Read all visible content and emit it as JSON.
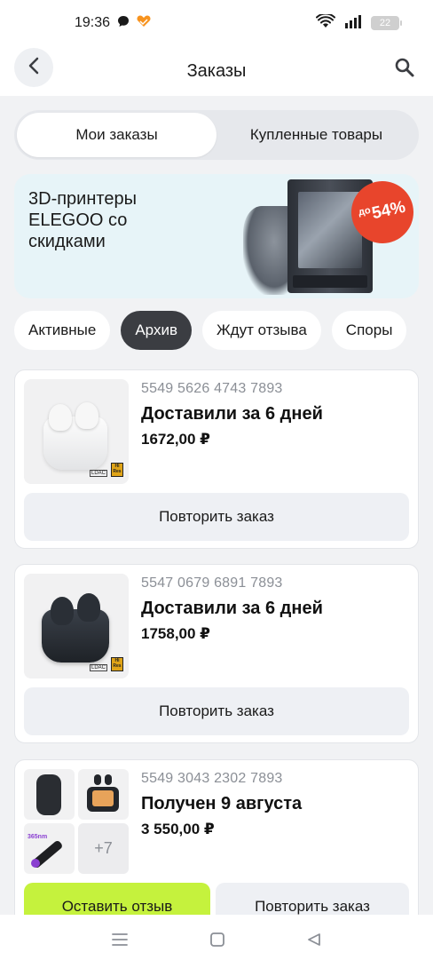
{
  "status_bar": {
    "time": "19:36",
    "battery": "22",
    "icons": [
      "chat-bubble-icon",
      "heart-app-icon",
      "wifi-icon",
      "signal-icon",
      "battery-icon"
    ]
  },
  "header": {
    "title": "Заказы",
    "back_icon": "chevron-left-icon",
    "search_icon": "search-icon"
  },
  "tabs": [
    {
      "label": "Мои заказы",
      "active": true
    },
    {
      "label": "Купленные товары",
      "active": false
    }
  ],
  "banner": {
    "text": "3D-принтеры ELEGOO со скидками",
    "badge_prefix": "до",
    "badge_value": "54%"
  },
  "filters": [
    {
      "label": "Активные",
      "active": false
    },
    {
      "label": "Архив",
      "active": true
    },
    {
      "label": "Ждут отзыва",
      "active": false
    },
    {
      "label": "Споры",
      "active": false
    }
  ],
  "orders": [
    {
      "number": "5549 5626 4743 7893",
      "status": "Доставили за 6 дней",
      "price": "1672,00 ₽",
      "button": "Повторить заказ"
    },
    {
      "number": "5547 0679 6891 7893",
      "status": "Доставили за 6 дней",
      "price": "1758,00 ₽",
      "button": "Повторить заказ"
    },
    {
      "number": "5549 3043 2302 7893",
      "status": "Получен 9 августа",
      "price": "3 550,00 ₽",
      "more_count": "+7",
      "button_review": "Оставить отзыв",
      "button_repeat": "Повторить заказ"
    }
  ],
  "colors": {
    "accent_green": "#c5f23d",
    "chip_active": "#3b3d42",
    "sale_red": "#e8452c"
  },
  "nav_bar": [
    "menu-icon",
    "home-square-icon",
    "back-triangle-icon"
  ]
}
